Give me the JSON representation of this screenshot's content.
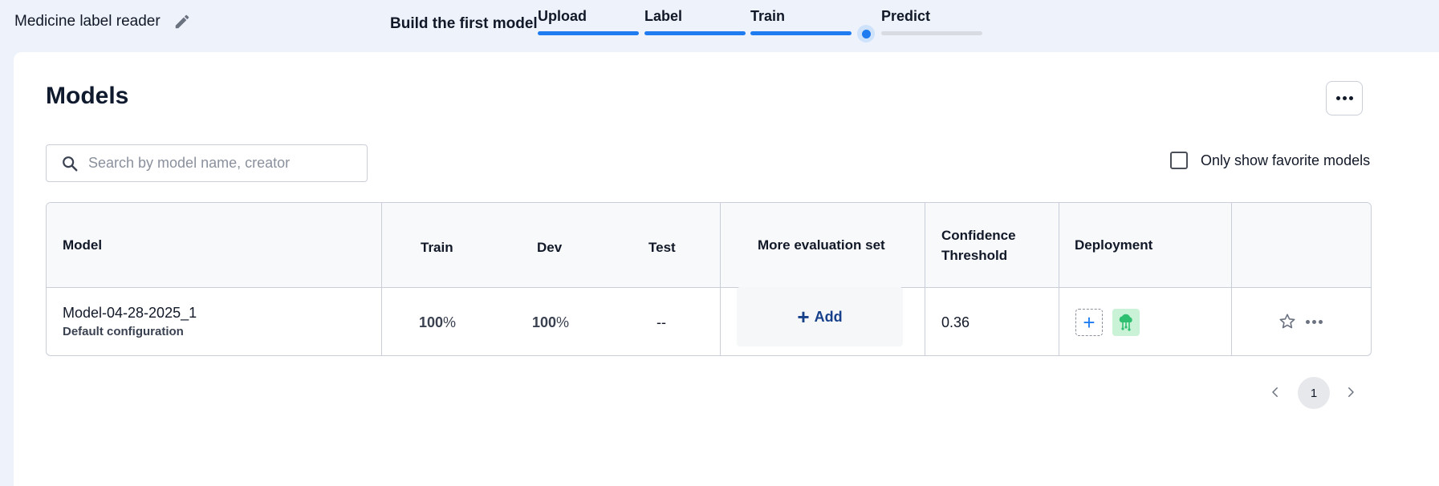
{
  "header": {
    "project_name": "Medicine label reader",
    "build_label": "Build the first model",
    "steps": [
      {
        "label": "Upload",
        "done": true
      },
      {
        "label": "Label",
        "done": true
      },
      {
        "label": "Train",
        "done": true
      },
      {
        "label": "Predict",
        "done": false,
        "current": true
      }
    ]
  },
  "main": {
    "title": "Models",
    "search": {
      "placeholder": "Search by model name, creator",
      "value": ""
    },
    "favorite_filter": {
      "label": "Only show favorite models",
      "checked": false
    }
  },
  "table": {
    "columns": {
      "model": "Model",
      "train": "Train",
      "dev": "Dev",
      "test": "Test",
      "more_eval": "More evaluation set",
      "confidence_line1": "Confidence",
      "confidence_line2": "Threshold",
      "deployment": "Deployment"
    },
    "rows": [
      {
        "name": "Model-04-28-2025_1",
        "config": "Default configuration",
        "train_value": "100",
        "dev_value": "100",
        "percent_sign": "%",
        "test": "--",
        "add_label": "Add",
        "add_icon": "+",
        "confidence": "0.36",
        "deploy_add_icon": "+"
      }
    ]
  },
  "pagination": {
    "current_page": "1"
  },
  "colors": {
    "accent": "#1f7cf0",
    "add_text": "#17408b",
    "deploy_green": "#c9f2d6",
    "background": "#eef2fb"
  },
  "icons": [
    "pencil-icon",
    "search-icon",
    "more-dots-icon",
    "plus-icon",
    "cloud-deploy-icon",
    "star-icon",
    "chevron-left-icon",
    "chevron-right-icon"
  ]
}
